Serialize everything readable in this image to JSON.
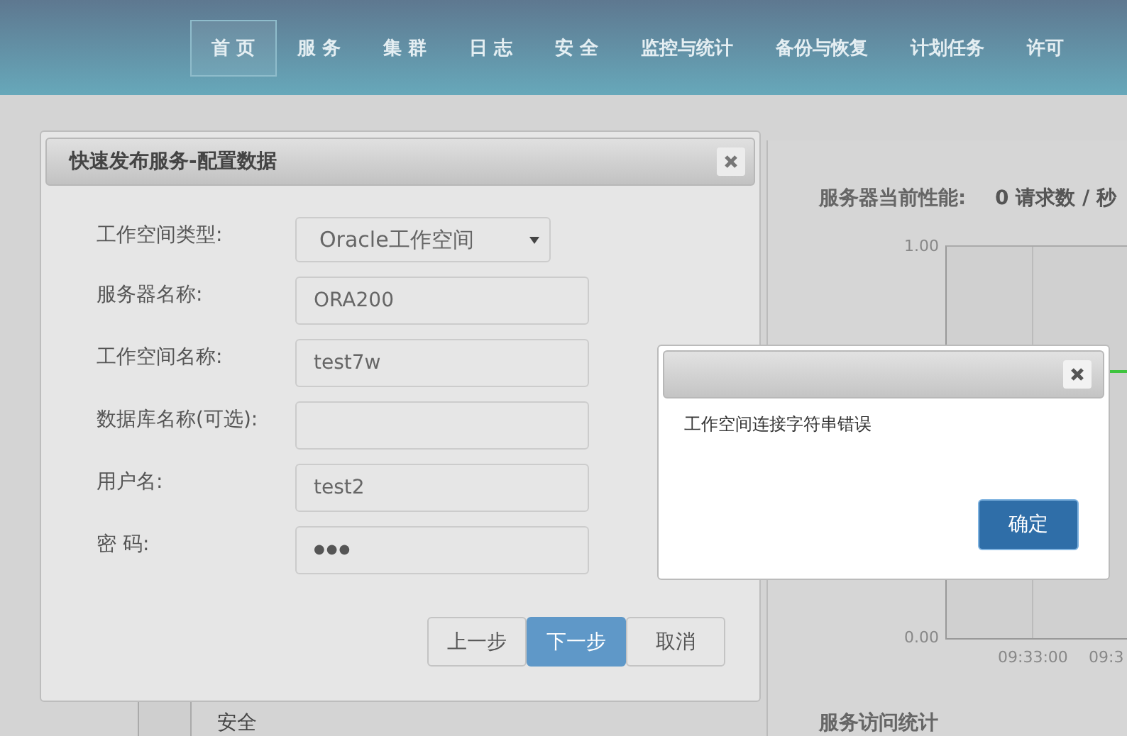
{
  "nav": [
    {
      "label": "首 页",
      "selected": true
    },
    {
      "label": "服 务",
      "selected": false
    },
    {
      "label": "集 群",
      "selected": false
    },
    {
      "label": "日 志",
      "selected": false
    },
    {
      "label": "安 全",
      "selected": false
    },
    {
      "label": "监控与统计",
      "selected": false
    },
    {
      "label": "备份与恢复",
      "selected": false
    },
    {
      "label": "计划任务",
      "selected": false
    },
    {
      "label": "许可",
      "selected": false
    }
  ],
  "background": {
    "performance_label": "服务器当前性能:",
    "performance_value": "0 请求数 / 秒",
    "chart": {
      "y_ticks": [
        "1.00",
        "0.00"
      ],
      "x_ticks": [
        "09:33:00",
        "09:3"
      ]
    },
    "section_title": "服务访问统计",
    "sidebar_item": "安全"
  },
  "dialog": {
    "title": "快速发布服务-配置数据",
    "fields": [
      {
        "label": "工作空间类型:",
        "kind": "select",
        "value": "Oracle工作空间"
      },
      {
        "label": "服务器名称:",
        "kind": "text",
        "value": "ORA200"
      },
      {
        "label": "工作空间名称:",
        "kind": "text",
        "value": "test7w"
      },
      {
        "label": "数据库名称(可选):",
        "kind": "text"
      },
      {
        "label": "用户名:",
        "kind": "text",
        "value": "test2"
      },
      {
        "label": "密 码:",
        "kind": "password",
        "value": "●●●"
      }
    ],
    "buttons": [
      {
        "label": "上一步",
        "primary": false
      },
      {
        "label": "下一步",
        "primary": true
      },
      {
        "label": "取消",
        "primary": false
      }
    ]
  },
  "alert": {
    "message": "工作空间连接字符串错误",
    "button": "确定"
  }
}
